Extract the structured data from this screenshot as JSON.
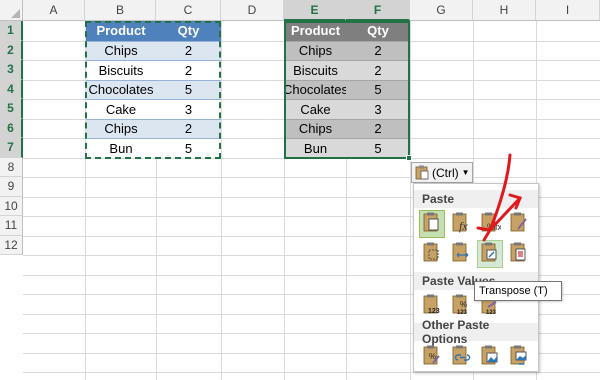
{
  "columns": [
    "A",
    "B",
    "C",
    "D",
    "E",
    "F",
    "G",
    "H",
    "I"
  ],
  "rows": [
    "1",
    "2",
    "3",
    "4",
    "5",
    "6",
    "7",
    "8",
    "9",
    "10",
    "11",
    "12"
  ],
  "source_table": {
    "headers": [
      "Product",
      "Qty"
    ],
    "rows": [
      [
        "Chips",
        "2"
      ],
      [
        "Biscuits",
        "2"
      ],
      [
        "Chocolates",
        "5"
      ],
      [
        "Cake",
        "3"
      ],
      [
        "Chips",
        "2"
      ],
      [
        "Bun",
        "5"
      ]
    ]
  },
  "pasted_table": {
    "headers": [
      "Product",
      "Qty"
    ],
    "rows": [
      [
        "Chips",
        "2"
      ],
      [
        "Biscuits",
        "2"
      ],
      [
        "Chocolates",
        "5"
      ],
      [
        "Cake",
        "3"
      ],
      [
        "Chips",
        "2"
      ],
      [
        "Bun",
        "5"
      ]
    ]
  },
  "paste_options": {
    "button_label": "(Ctrl)",
    "button_icon": "clipboard-icon",
    "sections": {
      "paste": "Paste",
      "paste_values": "Paste Values",
      "other": "Other Paste Options"
    },
    "tooltip": "Transpose (T)",
    "paste_icons": [
      "paste-icon",
      "formulas-icon",
      "formulas-number-formatting-icon",
      "keep-source-formatting-icon",
      "no-borders-icon",
      "keep-column-widths-icon",
      "transpose-icon",
      "keep-source-column-widths-icon"
    ],
    "values_icons": [
      "values-icon",
      "values-number-formatting-icon",
      "values-source-formatting-icon"
    ],
    "other_icons": [
      "formatting-icon",
      "paste-link-icon",
      "picture-icon",
      "linked-picture-icon"
    ]
  },
  "colors": {
    "header_blue": "#4f81bd",
    "band_blue": "#dce6f1",
    "excel_green": "#217346",
    "annotation_red": "#e0191f"
  }
}
